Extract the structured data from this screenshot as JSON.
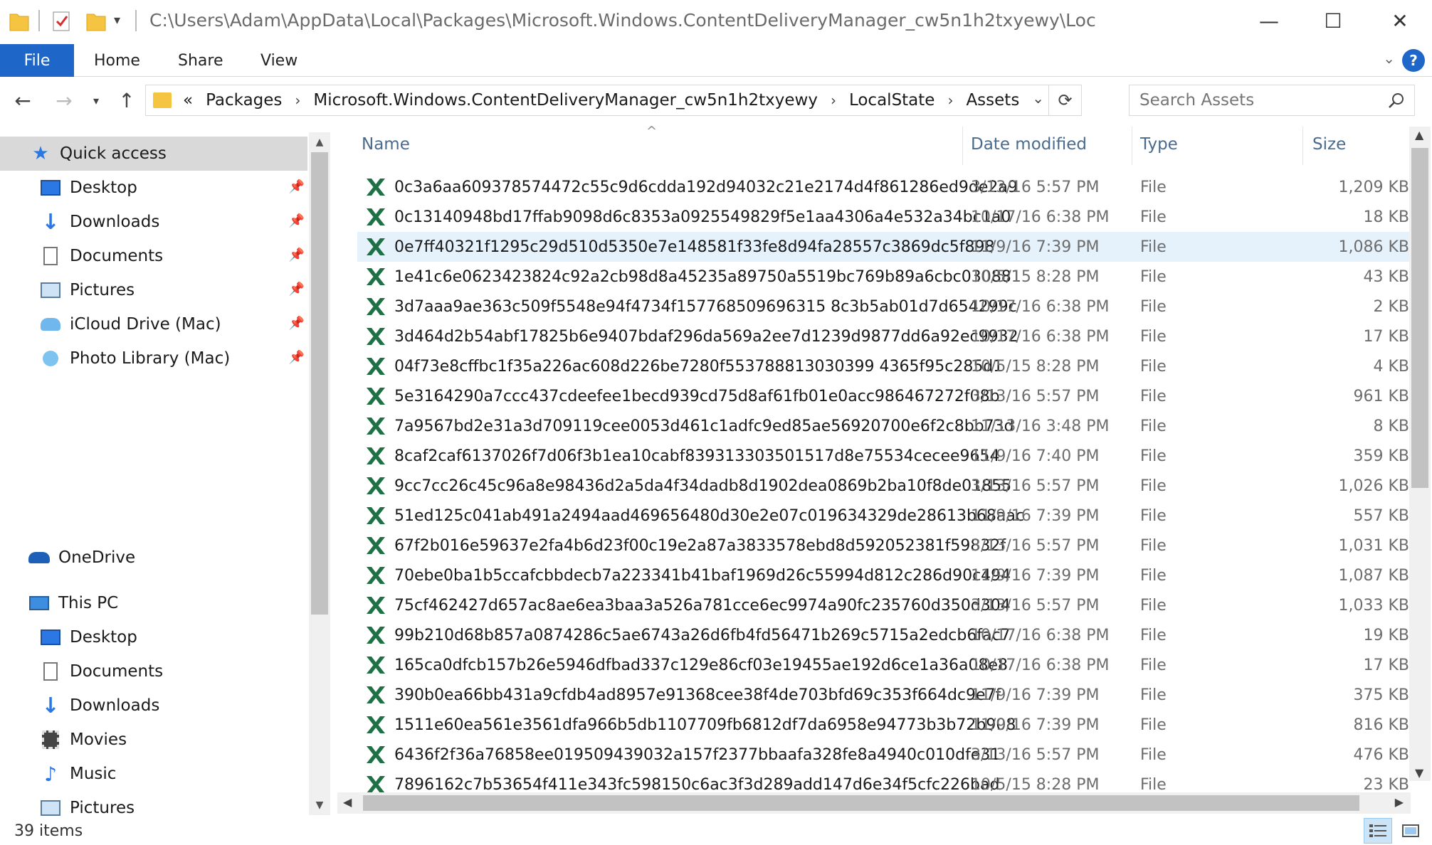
{
  "window": {
    "title_path": "C:\\Users\\Adam\\AppData\\Local\\Packages\\Microsoft.Windows.ContentDeliveryManager_cw5n1h2txyewy\\Loc",
    "controls": {
      "minimize": "—",
      "maximize": "☐",
      "close": "✕"
    }
  },
  "ribbon": {
    "tabs": [
      "File",
      "Home",
      "Share",
      "View"
    ],
    "help": "?"
  },
  "address": {
    "overflow": "«",
    "crumbs": [
      "Packages",
      "Microsoft.Windows.ContentDeliveryManager_cw5n1h2txyewy",
      "LocalState",
      "Assets"
    ]
  },
  "search": {
    "placeholder": "Search Assets"
  },
  "sidebar": {
    "quick_access": "Quick access",
    "quick_items": [
      {
        "label": "Desktop",
        "icon": "desktop-icon"
      },
      {
        "label": "Downloads",
        "icon": "downloads-icon"
      },
      {
        "label": "Documents",
        "icon": "documents-icon"
      },
      {
        "label": "Pictures",
        "icon": "pictures-icon"
      },
      {
        "label": "iCloud Drive (Mac)",
        "icon": "icloud-icon"
      },
      {
        "label": "Photo Library (Mac)",
        "icon": "photo-library-icon"
      }
    ],
    "onedrive": "OneDrive",
    "this_pc": "This PC",
    "pc_items": [
      {
        "label": "Desktop",
        "icon": "desktop-icon"
      },
      {
        "label": "Documents",
        "icon": "documents-icon"
      },
      {
        "label": "Downloads",
        "icon": "downloads-icon"
      },
      {
        "label": "Movies",
        "icon": "movies-icon"
      },
      {
        "label": "Music",
        "icon": "music-icon"
      },
      {
        "label": "Pictures",
        "icon": "pictures-icon"
      }
    ]
  },
  "columns": {
    "name": "Name",
    "date": "Date modified",
    "type": "Type",
    "size": "Size"
  },
  "files": [
    {
      "name": "0c3a6aa609378574472c55c9d6cdda192d94032c21e2174d4f861286ed9de2a9",
      "date": "3/13/16 5:57 PM",
      "type": "File",
      "size": "1,209 KB"
    },
    {
      "name": "0c13140948bd17ffab9098d6c8353a0925549829f5e1aa4306a4e532a34bc1a0",
      "date": "10/17/16 6:38 PM",
      "type": "File",
      "size": "18 KB"
    },
    {
      "name": "0e7ff40321f1295c29d510d5350e7e148581f33fe8d94fa28557c3869dc5f898",
      "date": "11/9/16 7:39 PM",
      "type": "File",
      "size": "1,086 KB",
      "highlight": true
    },
    {
      "name": "1e41c6e0623423824c92a2cb98d8a45235a89750a5519bc769b89a6cbc030881",
      "date": "10/5/15 8:28 PM",
      "type": "File",
      "size": "43 KB"
    },
    {
      "name": "3d7aaa9ae363c509f5548e94f4734f157768509696315 8c3b5ab01d7d654299c",
      "date": "10/17/16 6:38 PM",
      "type": "File",
      "size": "2 KB"
    },
    {
      "name": "3d464d2b54abf17825b6e9407bdaf296da569a2ee7d1239d9877dd6a92ec9932",
      "date": "10/17/16 6:38 PM",
      "type": "File",
      "size": "17 KB"
    },
    {
      "name": "04f73e8cffbc1f35a226ac608d226be7280f553788813030399 4365f95c285d1",
      "date": "10/5/15 8:28 PM",
      "type": "File",
      "size": "4 KB"
    },
    {
      "name": "5e3164290a7ccc437cdeefee1becd939cd75d8af61fb01e0acc986467272f08b",
      "date": "3/13/16 5:57 PM",
      "type": "File",
      "size": "961 KB"
    },
    {
      "name": "7a9567bd2e31a3d709119cee0053d461c1adfc9ed85ae56920700e6f2c8bb73d",
      "date": "11/13/16 3:48 PM",
      "type": "File",
      "size": "8 KB"
    },
    {
      "name": "8caf2caf6137026f7d06f3b1ea10cabf839313303501517d8e75534cecee9654",
      "date": "11/9/16 7:40 PM",
      "type": "File",
      "size": "359 KB"
    },
    {
      "name": "9cc7cc26c45c96a8e98436d2a5da4f34dadb8d1902dea0869b2ba10f8de01855",
      "date": "3/13/16 5:57 PM",
      "type": "File",
      "size": "1,026 KB"
    },
    {
      "name": "51ed125c041ab491a2494aad469656480d30e2e07c019634329de28613b68aac",
      "date": "11/9/16 7:39 PM",
      "type": "File",
      "size": "557 KB"
    },
    {
      "name": "67f2b016e59637e2fa4b6d23f00c19e2a87a3833578ebd8d592052381f59832f",
      "date": "3/13/16 5:57 PM",
      "type": "File",
      "size": "1,031 KB"
    },
    {
      "name": "70ebe0ba1b5ccafcbbdecb7a223341b41baf1969d26c55994d812c286d90c494",
      "date": "11/9/16 7:39 PM",
      "type": "File",
      "size": "1,087 KB"
    },
    {
      "name": "75cf462427d657ac8ae6ea3baa3a526a781cce6ec9974a90fc235760d350d304",
      "date": "3/13/16 5:57 PM",
      "type": "File",
      "size": "1,033 KB"
    },
    {
      "name": "99b210d68b857a0874286c5ae6743a26d6fb4fd56471b269c5715a2edcb6fac7",
      "date": "10/17/16 6:38 PM",
      "type": "File",
      "size": "19 KB"
    },
    {
      "name": "165ca0dfcb157b26e5946dfbad337c129e86cf03e19455ae192d6ce1a36a08e8",
      "date": "10/17/16 6:38 PM",
      "type": "File",
      "size": "17 KB"
    },
    {
      "name": "390b0ea66bb431a9cfdb4ad8957e91368cee38f4de703bfd69c353f664dc9e7f",
      "date": "11/9/16 7:39 PM",
      "type": "File",
      "size": "375 KB"
    },
    {
      "name": "1511e60ea561e3561dfa966b5db1107709fb6812df7da6958e94773b3b72b908",
      "date": "11/9/16 7:39 PM",
      "type": "File",
      "size": "816 KB"
    },
    {
      "name": "6436f2f36a76858ee019509439032a157f2377bbaafa328fe8a4940c010dfe31",
      "date": "3/13/16 5:57 PM",
      "type": "File",
      "size": "476 KB"
    },
    {
      "name": "7896162c7b53654f411e343fc598150c6ac3f3d289add147d6e34f5cfc226bad",
      "date": "10/5/15 8:28 PM",
      "type": "File",
      "size": "23 KB"
    }
  ],
  "status": {
    "count": "39 items"
  },
  "colors": {
    "accent": "#1e67c8",
    "highlight": "#e5f1fb",
    "excel_green": "#1e7145"
  }
}
